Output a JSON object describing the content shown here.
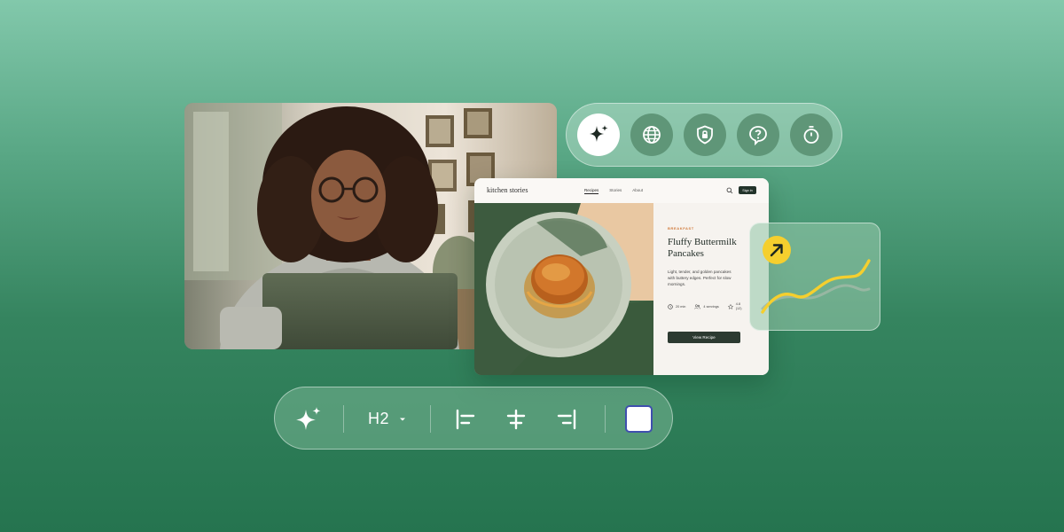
{
  "icon_toolbar": {
    "items": [
      {
        "icon": "sparkle-icon",
        "active": true
      },
      {
        "icon": "globe-icon",
        "active": false
      },
      {
        "icon": "shield-lock-icon",
        "active": false
      },
      {
        "icon": "help-icon",
        "active": false
      },
      {
        "icon": "stopwatch-icon",
        "active": false
      }
    ]
  },
  "recipe_page": {
    "brand": "kitchen stories",
    "nav_links": [
      "Recipes",
      "Stories",
      "About"
    ],
    "active_nav": "Recipes",
    "sign_in_label": "Sign in",
    "category": "BREAKFAST",
    "title": "Fluffy Buttermilk Pancakes",
    "description": "Light, tender, and golden pancakes with buttery edges. Perfect for slow mornings.",
    "meta": {
      "time": "20 min",
      "servings": "4 servings",
      "rating": "4.8",
      "rating_sub": "(12)"
    },
    "cta_label": "View Recipe"
  },
  "chart_widget": {
    "icon": "arrow-up-right-icon",
    "accent": "#f5cf2e"
  },
  "editor_toolbar": {
    "heading_level": "H2",
    "tools": [
      "sparkle-icon",
      "chevron-down-icon",
      "align-left-icon",
      "align-center-icon",
      "align-right-icon"
    ],
    "swatch_color": "#ffffff",
    "swatch_border": "#3f4fae"
  }
}
